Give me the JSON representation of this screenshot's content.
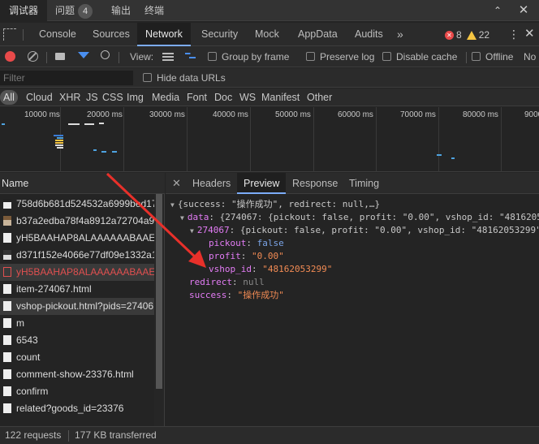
{
  "drawer": {
    "tabs": [
      {
        "label": "调试器"
      },
      {
        "label": "问题",
        "count": "4"
      },
      {
        "label": "输出"
      },
      {
        "label": "终端"
      }
    ]
  },
  "main_tabs": [
    "Console",
    "Sources",
    "Network",
    "Security",
    "Mock",
    "AppData",
    "Audits"
  ],
  "errors": "8",
  "warnings": "22",
  "toolbar": {
    "view_label": "View:",
    "group_by_frame": "Group by frame",
    "preserve_log": "Preserve log",
    "disable_cache": "Disable cache",
    "offline": "Offline",
    "no_throttling": "No"
  },
  "filter": {
    "placeholder": "Filter",
    "hide_data_urls": "Hide data URLs"
  },
  "types": [
    "All",
    "Cloud",
    "XHR",
    "JS",
    "CSS",
    "Img",
    "Media",
    "Font",
    "Doc",
    "WS",
    "Manifest",
    "Other"
  ],
  "timeline_ticks": [
    "10000 ms",
    "20000 ms",
    "30000 ms",
    "40000 ms",
    "50000 ms",
    "60000 ms",
    "70000 ms",
    "80000 ms",
    "9000"
  ],
  "requests_header": "Name",
  "requests": [
    {
      "name": "758d6b681d524532a6999bed17"
    },
    {
      "name": "b37a2edba78f4a8912a72704a9"
    },
    {
      "name": "yH5BAAHAP8ALAAAAAABAAEA"
    },
    {
      "name": "d371f152e4066e77df09e1332a1"
    },
    {
      "name": "yH5BAAHAP8ALAAAAAABAAEA"
    },
    {
      "name": "item-274067.html"
    },
    {
      "name": "vshop-pickout.html?pids=27406"
    },
    {
      "name": "m"
    },
    {
      "name": "6543"
    },
    {
      "name": "count"
    },
    {
      "name": "comment-show-23376.html"
    },
    {
      "name": "confirm"
    },
    {
      "name": "related?goods_id=23376"
    }
  ],
  "detail_tabs": [
    "Headers",
    "Preview",
    "Response",
    "Timing"
  ],
  "preview": {
    "l1": "{success: \"操作成功\", redirect: null,…}",
    "l2_key": "data",
    "l2_val": "{274067: {pickout: false, profit: \"0.00\", vshop_id: \"4816205",
    "l3_key": "274067",
    "l3_val": "{pickout: false, profit: \"0.00\", vshop_id: \"48162053299\"",
    "pickout_key": "pickout",
    "pickout_val": "false",
    "profit_key": "profit",
    "profit_val": "\"0.00\"",
    "vshop_key": "vshop_id",
    "vshop_val": "\"48162053299\"",
    "redirect_key": "redirect",
    "redirect_val": "null",
    "success_key": "success",
    "success_val": "\"操作成功\""
  },
  "status": {
    "requests": "122 requests",
    "transferred": "177 KB transferred"
  },
  "colors": {
    "accent": "#7cacf8",
    "record": "#e94a4a",
    "arrow": "#e8302a"
  }
}
